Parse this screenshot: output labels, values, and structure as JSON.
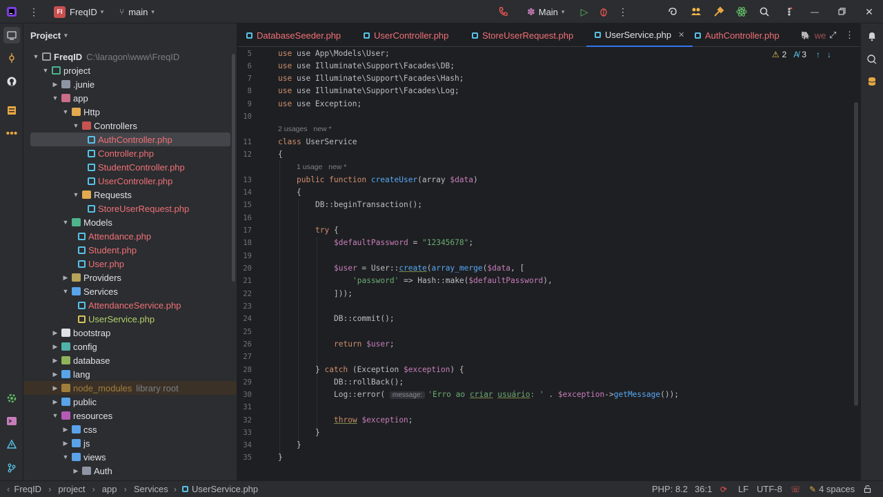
{
  "titlebar": {
    "project_badge": "FI",
    "project_name": "FreqID",
    "branch": "main",
    "run_config": "Main"
  },
  "sidebar": {
    "title": "Project",
    "root_name": "FreqID",
    "root_path": "C:\\laragon\\www\\FreqID",
    "items": [
      {
        "label": "project"
      },
      {
        "label": ".junie"
      },
      {
        "label": "app"
      },
      {
        "label": "Http"
      },
      {
        "label": "Controllers"
      },
      {
        "label": "AuthController.php"
      },
      {
        "label": "Controller.php"
      },
      {
        "label": "StudentController.php"
      },
      {
        "label": "UserController.php"
      },
      {
        "label": "Requests"
      },
      {
        "label": "StoreUserRequest.php"
      },
      {
        "label": "Models"
      },
      {
        "label": "Attendance.php"
      },
      {
        "label": "Student.php"
      },
      {
        "label": "User.php"
      },
      {
        "label": "Providers"
      },
      {
        "label": "Services"
      },
      {
        "label": "AttendanceService.php"
      },
      {
        "label": "UserService.php"
      },
      {
        "label": "bootstrap"
      },
      {
        "label": "config"
      },
      {
        "label": "database"
      },
      {
        "label": "lang"
      },
      {
        "label": "node_modules",
        "note": "library root"
      },
      {
        "label": "public"
      },
      {
        "label": "resources"
      },
      {
        "label": "css"
      },
      {
        "label": "js"
      },
      {
        "label": "views"
      },
      {
        "label": "Auth"
      }
    ]
  },
  "tabs": [
    {
      "label": "DatabaseSeeder.php"
    },
    {
      "label": "UserController.php"
    },
    {
      "label": "StoreUserRequest.php"
    },
    {
      "label": "UserService.php"
    },
    {
      "label": "AuthController.php"
    },
    {
      "label": "we"
    }
  ],
  "editor": {
    "warnings": "2",
    "typos": "3",
    "lines": {
      "l5": "use App\\Models\\User;",
      "l6": "use Illuminate\\Support\\Facades\\DB;",
      "l7": "use Illuminate\\Support\\Facades\\Hash;",
      "l8": "use Illuminate\\Support\\Facades\\Log;",
      "l9": "use Exception;",
      "hint1": "2 usages   new *",
      "l11_kw": "class",
      "l11_name": "UserService",
      "l12": "{",
      "hint2": "1 usage   new *",
      "l13_kw1": "public",
      "l13_kw2": "function",
      "l13_fn": "createUser",
      "l13_p1": "(array ",
      "l13_var": "$data",
      "l13_p2": ")",
      "l14": "{",
      "l15_cls": "DB::",
      "l15_fn": "beginTransaction",
      "l15_end": "();",
      "l17_kw": "try",
      "l17_end": " {",
      "l18_var": "$defaultPassword",
      "l18_eq": " = ",
      "l18_str": "\"12345678\"",
      "l18_end": ";",
      "l20_var": "$user",
      "l20_eq": " = User::",
      "l20_fn": "create",
      "l20_p": "(",
      "l20_fn2": "array_merge",
      "l20_p2": "(",
      "l20_var2": "$data",
      "l20_end": ", [",
      "l21_str": "'password'",
      "l21_mid": " => Hash::",
      "l21_fn": "make",
      "l21_p": "(",
      "l21_var": "$defaultPassword",
      "l21_end": "),",
      "l22": "]));",
      "l24_cls": "DB::",
      "l24_fn": "commit",
      "l24_end": "();",
      "l26_kw": "return",
      "l26_var": "$user",
      "l26_end": ";",
      "l28_a": "} ",
      "l28_kw": "catch",
      "l28_b": " (Exception ",
      "l28_var": "$exception",
      "l28_c": ") {",
      "l29_cls": "DB::",
      "l29_fn": "rollBack",
      "l29_end": "();",
      "l30_cls": "Log::",
      "l30_fn": "error",
      "l30_p": "(",
      "l30_hint": "message:",
      "l30_str1": "'Erro ao ",
      "l30_str2": "criar",
      "l30_str3": " ",
      "l30_str4": "usuário",
      "l30_str5": ": '",
      "l30_dot": " . ",
      "l30_var": "$exception",
      "l30_arrow": "->",
      "l30_fn2": "getMessage",
      "l30_end": "());",
      "l32_kw": "throw",
      "l32_var": "$exception",
      "l32_end": ";",
      "l33": "}",
      "l34": "}",
      "l35": "}"
    }
  },
  "statusbar": {
    "breadcrumb": [
      "FreqID",
      "project",
      "app",
      "Services",
      "UserService.php"
    ],
    "php_version": "PHP: 8.2",
    "cursor": "36:1",
    "line_sep": "LF",
    "encoding": "UTF-8",
    "indent": "4 spaces"
  }
}
